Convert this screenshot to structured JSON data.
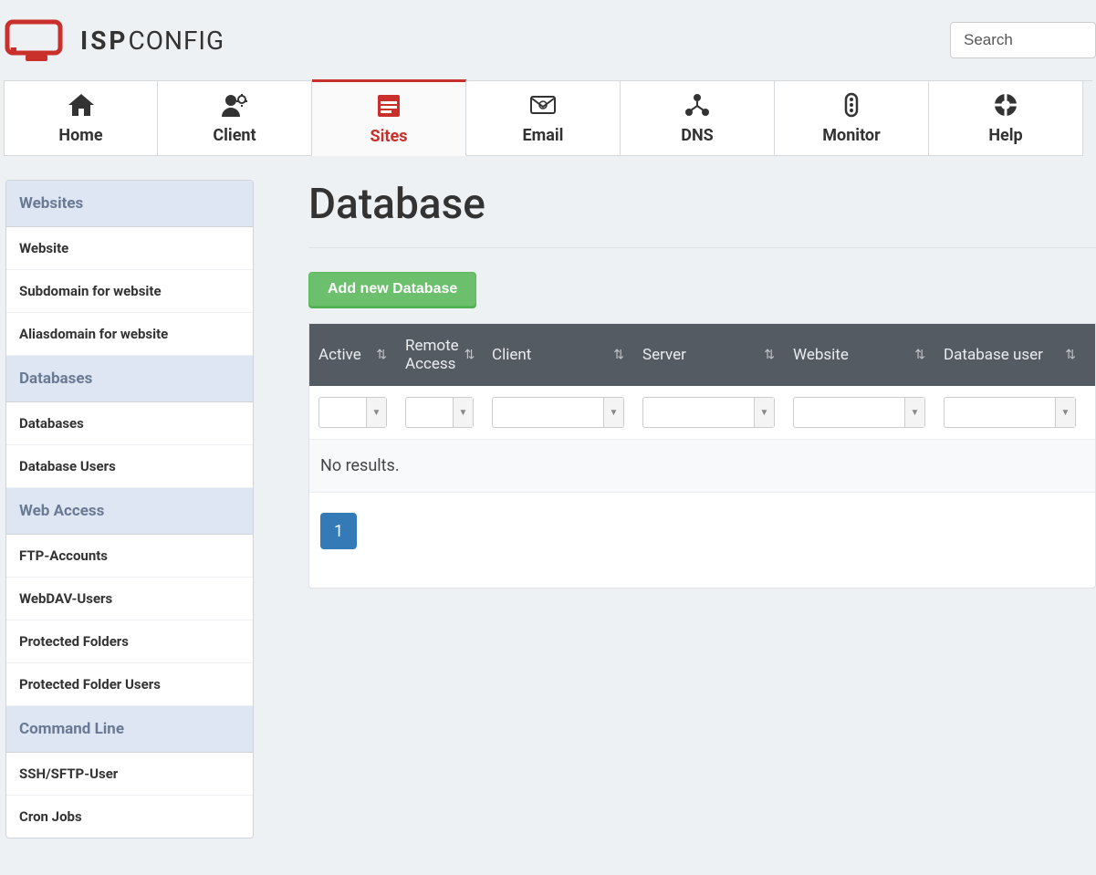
{
  "search": {
    "placeholder": "Search"
  },
  "logo": {
    "text_bold": "ISP",
    "text_rest": "CONFIG"
  },
  "mainnav": [
    {
      "key": "home",
      "label": "Home",
      "active": false
    },
    {
      "key": "client",
      "label": "Client",
      "active": false
    },
    {
      "key": "sites",
      "label": "Sites",
      "active": true
    },
    {
      "key": "email",
      "label": "Email",
      "active": false
    },
    {
      "key": "dns",
      "label": "DNS",
      "active": false
    },
    {
      "key": "monitor",
      "label": "Monitor",
      "active": false
    },
    {
      "key": "help",
      "label": "Help",
      "active": false
    }
  ],
  "sidebar": [
    {
      "type": "head",
      "label": "Websites"
    },
    {
      "type": "link",
      "label": "Website"
    },
    {
      "type": "link",
      "label": "Subdomain for website"
    },
    {
      "type": "link",
      "label": "Aliasdomain for website"
    },
    {
      "type": "head",
      "label": "Databases"
    },
    {
      "type": "link",
      "label": "Databases"
    },
    {
      "type": "link",
      "label": "Database Users"
    },
    {
      "type": "head",
      "label": "Web Access"
    },
    {
      "type": "link",
      "label": "FTP-Accounts"
    },
    {
      "type": "link",
      "label": "WebDAV-Users"
    },
    {
      "type": "link",
      "label": "Protected Folders"
    },
    {
      "type": "link",
      "label": "Protected Folder Users"
    },
    {
      "type": "head",
      "label": "Command Line"
    },
    {
      "type": "link",
      "label": "SSH/SFTP-User"
    },
    {
      "type": "link",
      "label": "Cron Jobs"
    }
  ],
  "page": {
    "title": "Database",
    "add_button": "Add new Database",
    "columns": {
      "active": "Active",
      "remote": "Remote Access",
      "client": "Client",
      "server": "Server",
      "website": "Website",
      "dbuser": "Database user"
    },
    "no_results": "No results.",
    "pagination": {
      "current": "1"
    }
  }
}
